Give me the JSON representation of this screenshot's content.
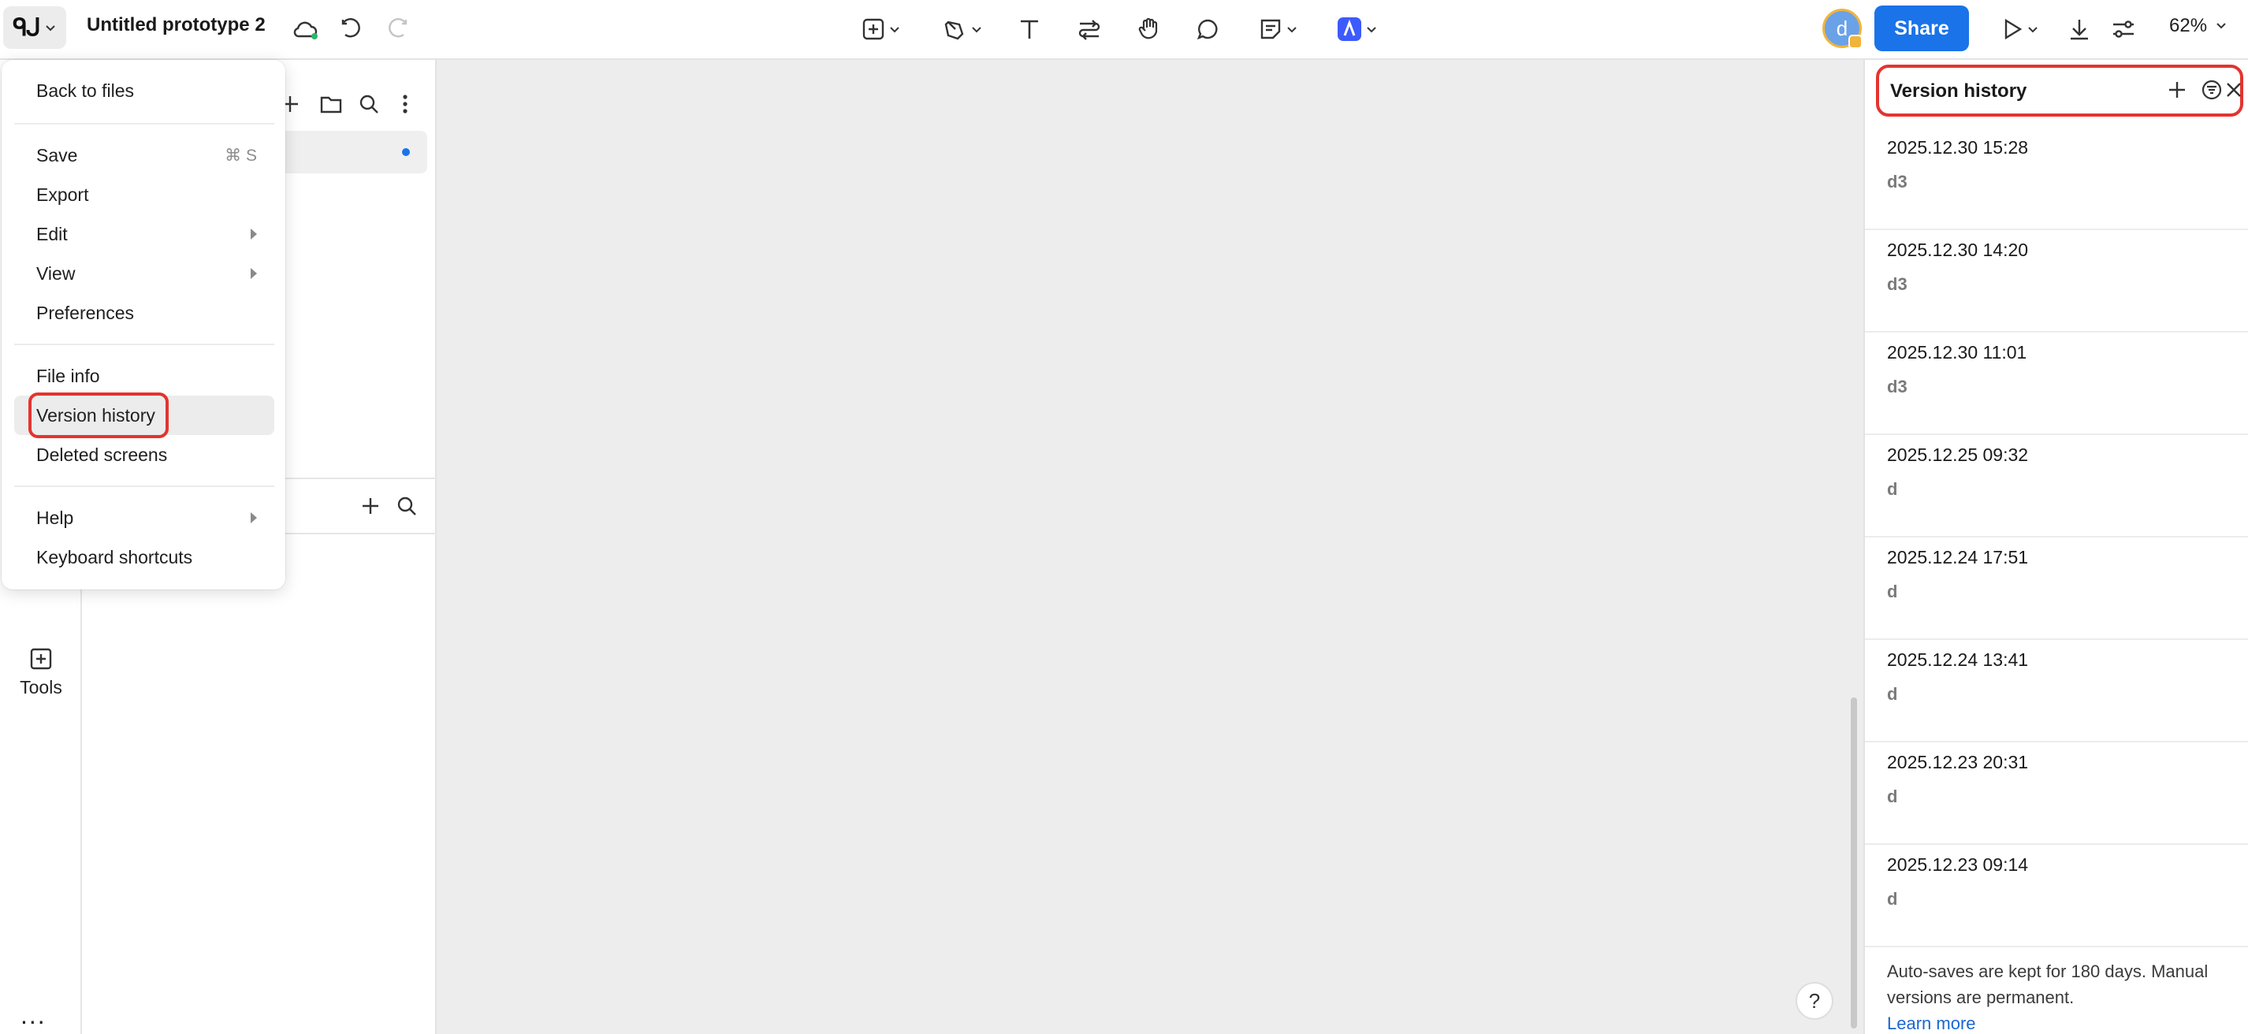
{
  "app": {
    "document_title": "Untitled prototype 2",
    "share_label": "Share",
    "zoom_label": "62%",
    "avatar_initial": "d"
  },
  "left_rail": {
    "tools_label": "Tools",
    "more_label": "..."
  },
  "menu": {
    "items": [
      {
        "label": "Back to files"
      },
      {
        "label": "Save",
        "shortcut": "⌘ S"
      },
      {
        "label": "Export"
      },
      {
        "label": "Edit"
      },
      {
        "label": "View"
      },
      {
        "label": "Preferences"
      },
      {
        "label": "File info"
      },
      {
        "label": "Version history"
      },
      {
        "label": "Deleted screens"
      },
      {
        "label": "Help"
      },
      {
        "label": "Keyboard shortcuts"
      }
    ]
  },
  "version_history": {
    "title": "Version history",
    "entries": [
      {
        "time": "2025.12.30 15:28",
        "author": "d3"
      },
      {
        "time": "2025.12.30 14:20",
        "author": "d3"
      },
      {
        "time": "2025.12.30 11:01",
        "author": "d3"
      },
      {
        "time": "2025.12.25 09:32",
        "author": "d"
      },
      {
        "time": "2025.12.24 17:51",
        "author": "d"
      },
      {
        "time": "2025.12.24 13:41",
        "author": "d"
      },
      {
        "time": "2025.12.23 20:31",
        "author": "d"
      },
      {
        "time": "2025.12.23 09:14",
        "author": "d"
      }
    ],
    "footer_text": "Auto-saves are kept for 180 days. Manual versions are permanent.",
    "learn_more": "Learn more"
  },
  "help_label": "?",
  "colors": {
    "accent": "#1a73e8",
    "highlight_ring": "#e3342f",
    "canvas": "#ededed"
  }
}
